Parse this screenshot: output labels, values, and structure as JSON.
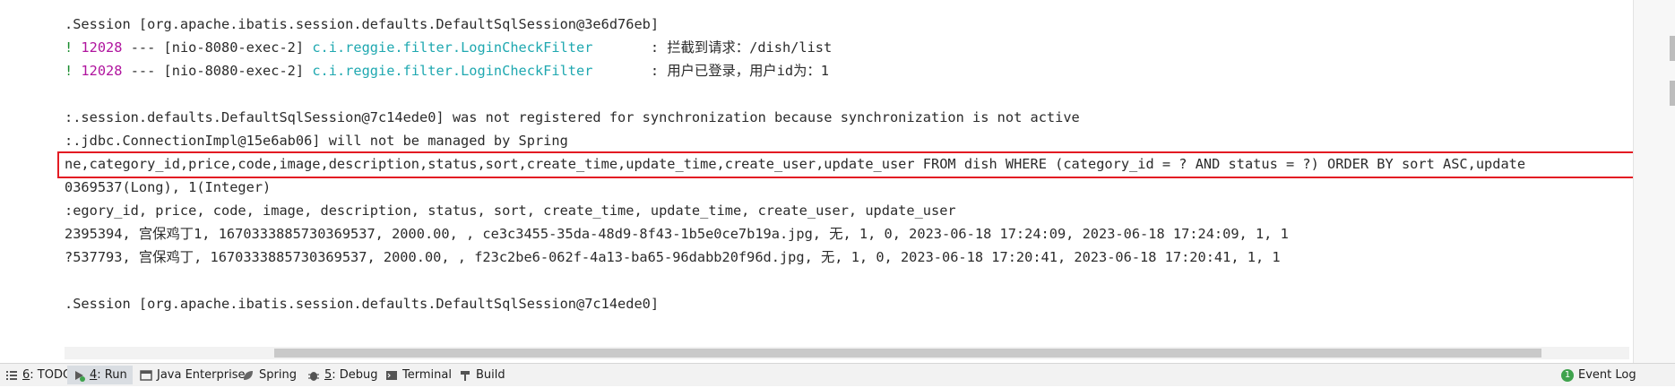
{
  "console": {
    "lines": [
      {
        "plain": ".Session [org.apache.ibatis.session.defaults.DefaultSqlSession@3e6d76eb]"
      },
      {
        "prefix": "! ",
        "pid": "12028",
        "thread": " --- [nio-8080-exec-2] ",
        "logger": "c.i.reggie.filter.LoginCheckFilter",
        "message": "       : 拦截到请求：/dish/list"
      },
      {
        "prefix": "! ",
        "pid": "12028",
        "thread": " --- [nio-8080-exec-2] ",
        "logger": "c.i.reggie.filter.LoginCheckFilter",
        "message": "       : 用户已登录，用户id为：1"
      },
      {
        "plain": ""
      },
      {
        "plain": ":.session.defaults.DefaultSqlSession@7c14ede0] was not registered for synchronization because synchronization is not active"
      },
      {
        "plain": ":.jdbc.ConnectionImpl@15e6ab06] will not be managed by Spring"
      },
      {
        "plain": "ne,category_id,price,code,image,description,status,sort,create_time,update_time,create_user,update_user FROM dish WHERE (category_id = ? AND status = ?) ORDER BY sort ASC,update"
      },
      {
        "plain": "0369537(Long), 1(Integer)"
      },
      {
        "plain": ":egory_id, price, code, image, description, status, sort, create_time, update_time, create_user, update_user"
      },
      {
        "plain": "2395394, 宫保鸡丁1, 1670333885730369537, 2000.00, , ce3c3455-35da-48d9-8f43-1b5e0ce7b19a.jpg, 无, 1, 0, 2023-06-18 17:24:09, 2023-06-18 17:24:09, 1, 1"
      },
      {
        "plain": "?537793, 宫保鸡丁, 1670333885730369537, 2000.00, , f23c2be6-062f-4a13-ba65-96dabb20f96d.jpg, 无, 1, 0, 2023-06-18 17:20:41, 2023-06-18 17:20:41, 1, 1"
      },
      {
        "plain": ""
      },
      {
        "plain": ".Session [org.apache.ibatis.session.defaults.DefaultSqlSession@7c14ede0]"
      }
    ]
  },
  "statusbar": {
    "tabs": [
      {
        "num": "6",
        "label": ": TODO",
        "icon": "todo-list-icon"
      },
      {
        "num": "4",
        "label": ": Run",
        "icon": "run-play-icon"
      },
      {
        "num": "",
        "label": "Java Enterprise",
        "icon": "java-enterprise-icon"
      },
      {
        "num": "",
        "label": "Spring",
        "icon": "spring-leaf-icon"
      },
      {
        "num": "5",
        "label": ": Debug",
        "icon": "debug-bug-icon"
      },
      {
        "num": "",
        "label": "Terminal",
        "icon": "terminal-icon"
      },
      {
        "num": "",
        "label": "Build",
        "icon": "build-hammer-icon"
      }
    ],
    "event_log": {
      "badge": "1",
      "label": "Event Log"
    }
  },
  "colors": {
    "highlight_border": "#e31b23",
    "pid": "#b0149e",
    "logger": "#1fa8b0",
    "level_marker": "#1a8c2e"
  }
}
